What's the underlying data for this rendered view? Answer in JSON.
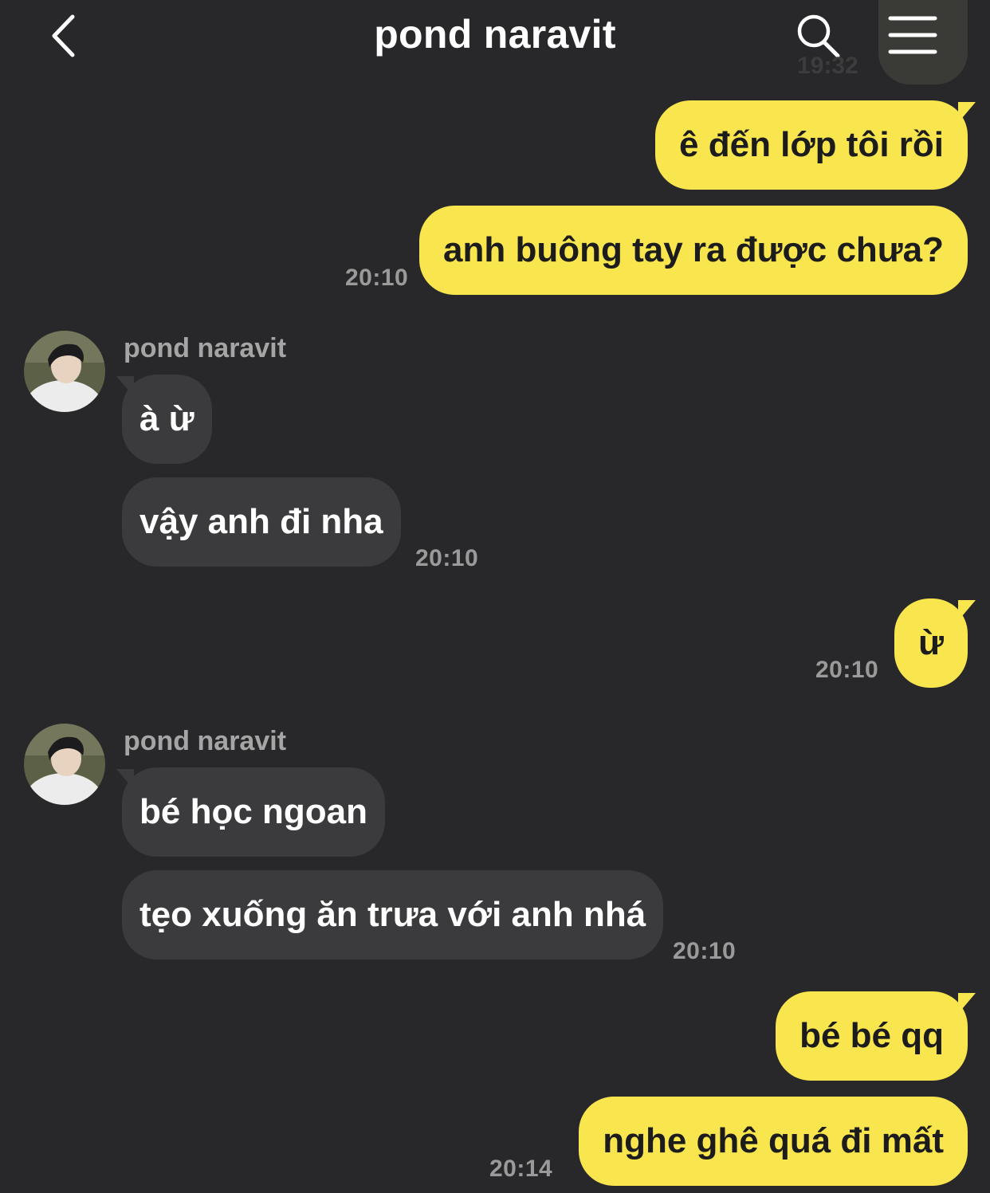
{
  "header": {
    "title": "pond naravit",
    "ghost_time": "19:32"
  },
  "messages": [
    {
      "text": "ê đến lớp tôi rồi"
    },
    {
      "text": "anh buông tay ra được chưa?",
      "time": "20:10"
    },
    {
      "sender": "pond naravit",
      "text": "à ừ"
    },
    {
      "text": "vậy anh đi nha",
      "time": "20:10"
    },
    {
      "text": "ừ",
      "time": "20:10"
    },
    {
      "sender": "pond naravit",
      "text": "bé học ngoan"
    },
    {
      "text": "tẹo xuống ăn trưa với anh nhá",
      "time": "20:10"
    },
    {
      "text": "bé bé qq"
    },
    {
      "text": "nghe ghê quá đi mất",
      "time": "20:14"
    }
  ],
  "colors": {
    "background": "#28282a",
    "outgoing_bubble": "#f9e54e",
    "incoming_bubble": "#3b3b3d"
  },
  "icons": {
    "back": "chevron-left-icon",
    "search": "search-icon",
    "menu": "menu-icon",
    "avatar": "avatar"
  }
}
